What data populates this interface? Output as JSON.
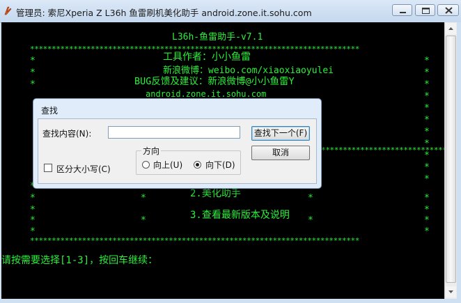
{
  "window": {
    "title": "管理员:  索尼Xperia Z L36h 鱼雷刷机美化助手 android.zone.it.sohu.com",
    "buttons": {
      "minimize": "minimize",
      "maximize": "maximize",
      "close": "close"
    }
  },
  "console": {
    "header_title": "L36h-鱼雷助手-v7.1",
    "star_row": "****************************************************************************",
    "star": "*",
    "author": "工具作者：小小鱼雷",
    "weibo": "新浪微博：weibo.com/xiaoxiaoyulei",
    "bug_report": "BUG反馈及建议：新浪微博@小小鱼雷Y",
    "site": "android.zone.it.sohu.com",
    "menu_item_2": "2.美化助手",
    "menu_item_3": "3.查看最新版本及说明",
    "prompt": "请按需要选择[1-3]，按回车继续："
  },
  "find_dialog": {
    "title": "查找",
    "find_label": "查找内容(N):",
    "find_value": "",
    "find_next_button": "查找下一个(F)",
    "cancel_button": "取消",
    "match_case_label": "区分大小写(C)",
    "match_case_checked": false,
    "direction_group_label": "方向",
    "direction_up": "向上(U)",
    "direction_down": "向下(D)",
    "direction_selected": "down"
  },
  "colors": {
    "console_text": "#2bf03a",
    "console_bg": "#000000",
    "dialog_bg": "#e0ecf9"
  }
}
